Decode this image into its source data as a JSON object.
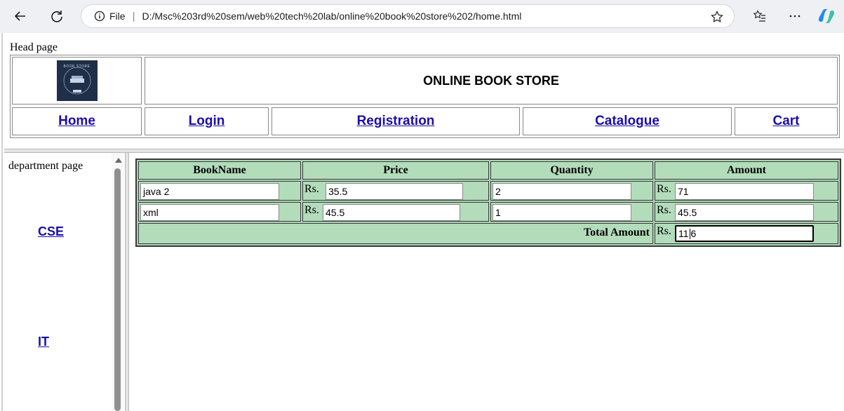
{
  "browser": {
    "scheme_label": "File",
    "url": "D:/Msc%203rd%20sem/web%20tech%20lab/online%20book%20store%202/home.html",
    "icons": [
      "back-icon",
      "refresh-icon",
      "info-icon",
      "favorite-star-icon",
      "favorites-list-icon",
      "more-icon",
      "copilot-icon"
    ]
  },
  "head": {
    "caption": "Head page",
    "logo_text": "BOOK STORE",
    "title": "ONLINE BOOK STORE",
    "nav": [
      {
        "label": "Home"
      },
      {
        "label": "Login"
      },
      {
        "label": "Registration"
      },
      {
        "label": "Catalogue"
      },
      {
        "label": "Cart"
      }
    ]
  },
  "department": {
    "caption": "department page",
    "links": [
      {
        "label": "CSE"
      },
      {
        "label": "IT"
      }
    ]
  },
  "cart": {
    "headers": [
      "BookName",
      "Price",
      "Quantity",
      "Amount"
    ],
    "currency": "Rs.",
    "rows": [
      {
        "book": "java 2",
        "price": "35.5",
        "quantity": "2",
        "amount": "71"
      },
      {
        "book": "xml",
        "price": "45.5",
        "quantity": "1",
        "amount": "45.5"
      }
    ],
    "total_label": "Total Amount",
    "total_before_caret": "11",
    "total_after_caret": "6"
  },
  "colors": {
    "table_bg": "#b3dcbb",
    "link": "#1a0dab",
    "logo_bg": "#1e2f47"
  }
}
